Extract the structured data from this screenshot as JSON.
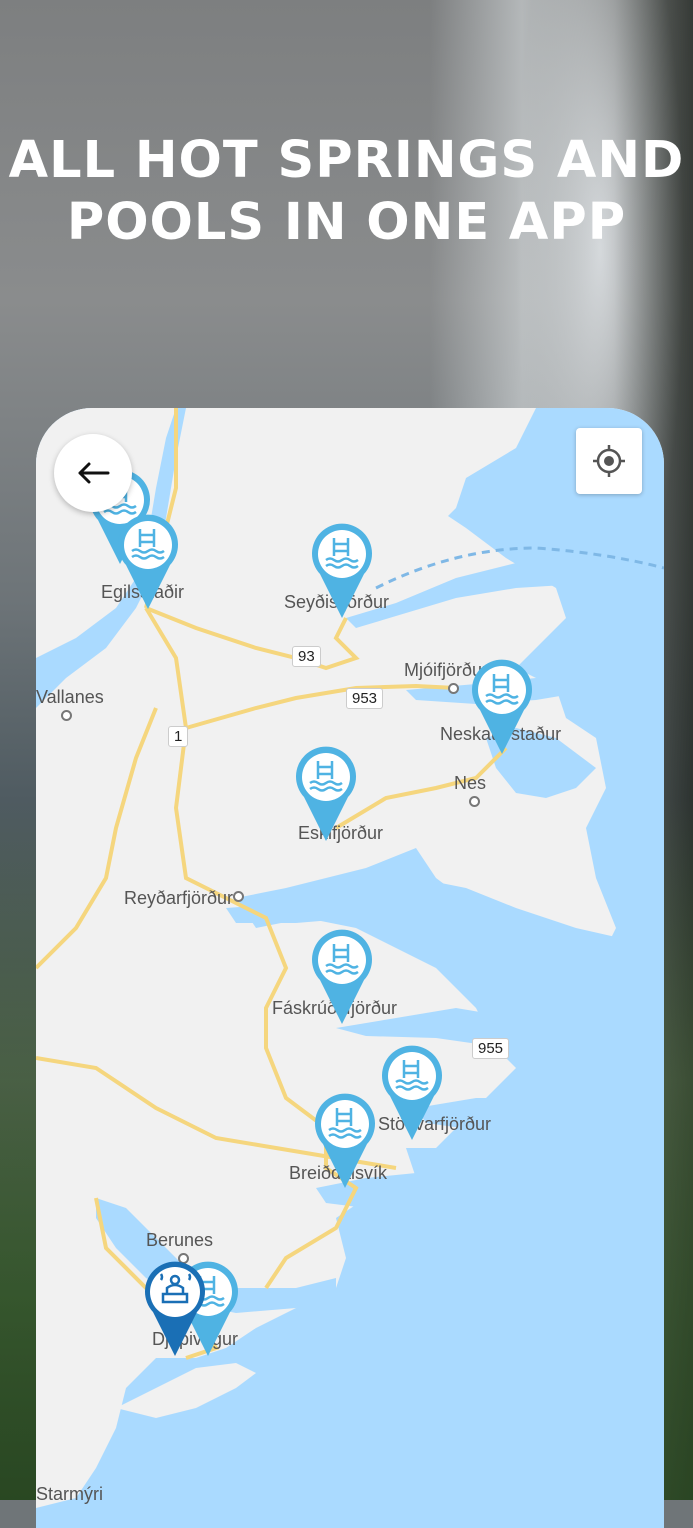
{
  "headline": {
    "line1": "ALL HOT SPRINGS AND",
    "line2": "POOLS IN ONE APP"
  },
  "controls": {
    "back_icon": "arrow-left-icon",
    "locate_icon": "crosshair-locate-icon"
  },
  "map": {
    "places": [
      {
        "id": "egilsstadir",
        "label": "Egilsstaðir"
      },
      {
        "id": "seydisfjordur",
        "label": "Seyðisfjörður"
      },
      {
        "id": "vallanes",
        "label": "Vallanes"
      },
      {
        "id": "mjoifjordur",
        "label": "Mjóifjörður"
      },
      {
        "id": "neskaupstadur",
        "label": "Neskaupstaður"
      },
      {
        "id": "nes",
        "label": "Nes"
      },
      {
        "id": "eskifjordur",
        "label": "Eskifjörður"
      },
      {
        "id": "reydarfjordur",
        "label": "Reyðarfjörður"
      },
      {
        "id": "faskrudsfjordur",
        "label": "Fáskrúðsfjörður"
      },
      {
        "id": "stodvarfjordur",
        "label": "Stöðvarfjörður"
      },
      {
        "id": "breiddalsvik",
        "label": "Breiðdalsvík"
      },
      {
        "id": "berunes",
        "label": "Berunes"
      },
      {
        "id": "djupivogur",
        "label": "Djúpivogur"
      },
      {
        "id": "starmyri",
        "label": "Starmýri"
      }
    ],
    "roads": [
      "93",
      "953",
      "1",
      "955"
    ],
    "pins": [
      {
        "type": "pool",
        "icon": "pool-ladder-icon",
        "color": "#4fb3e3"
      },
      {
        "type": "hot-spring",
        "icon": "hot-spring-bath-icon",
        "color": "#1a6fb5"
      }
    ]
  },
  "colors": {
    "water": "#aadaff",
    "land": "#f1f1f1",
    "road": "#f5d67e",
    "pin_pool": "#4fb3e3",
    "pin_hotspring": "#1a6fb5"
  }
}
